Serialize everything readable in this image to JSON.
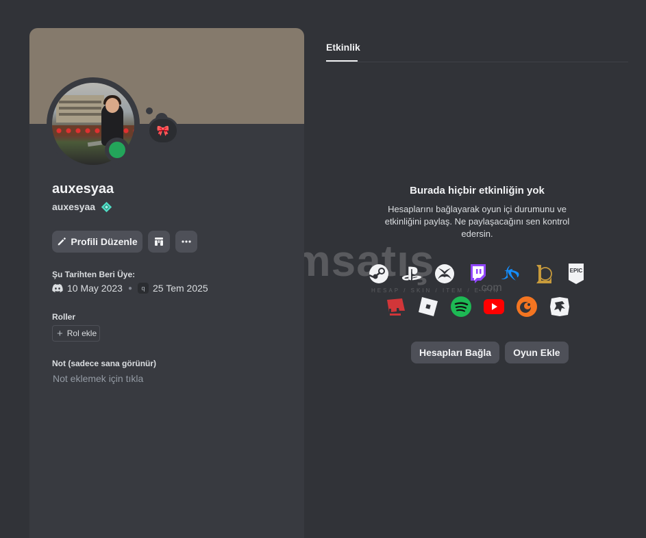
{
  "profile": {
    "display_name": "auxesyaa",
    "username": "auxesyaa",
    "edit_button": "Profili Düzenle",
    "status": "online",
    "status_color": "#23a55a",
    "banner_color": "#857a6c",
    "member_since_title": "Şu Tarihten Beri Üye:",
    "discord_since": "10 May 2023",
    "server_since": "25 Tem 2025",
    "server_initial": "q",
    "roles_title": "Roller",
    "add_role_label": "Rol ekle",
    "note_title": "Not (sadece sana görünür)",
    "note_placeholder": "Not eklemek için tıkla"
  },
  "activity": {
    "tab_label": "Etkinlik",
    "empty_title": "Burada hiçbir etkinliğin yok",
    "empty_desc": "Hesaplarını bağlayarak oyun içi durumunu ve etkinliğini paylaş. Ne paylaşacağını sen kontrol edersin.",
    "connect_button": "Hesapları Bağla",
    "add_game_button": "Oyun Ekle",
    "platform_icons_row1": [
      "steam-icon",
      "playstation-icon",
      "xbox-icon",
      "twitch-icon",
      "battlenet-icon",
      "league-of-legends-icon",
      "epic-games-icon"
    ],
    "platform_icons_row2": [
      "riot-games-icon",
      "roblox-icon",
      "spotify-icon",
      "youtube-icon",
      "crunchyroll-icon",
      "bungie-icon"
    ],
    "epic_label": "EPIC"
  },
  "watermark": {
    "brand": "itemsatış",
    "tagline": "HESAP / SKIN / ITEM / E-PIN",
    "domain": ".com"
  },
  "colors": {
    "background": "#313338",
    "card": "#383a40",
    "button": "#4e5058",
    "twitch": "#9146ff",
    "battlenet": "#148eff",
    "league": "#c89b3c",
    "riot": "#d13639",
    "spotify": "#1db954",
    "youtube": "#ff0000",
    "crunchyroll": "#f47521"
  }
}
